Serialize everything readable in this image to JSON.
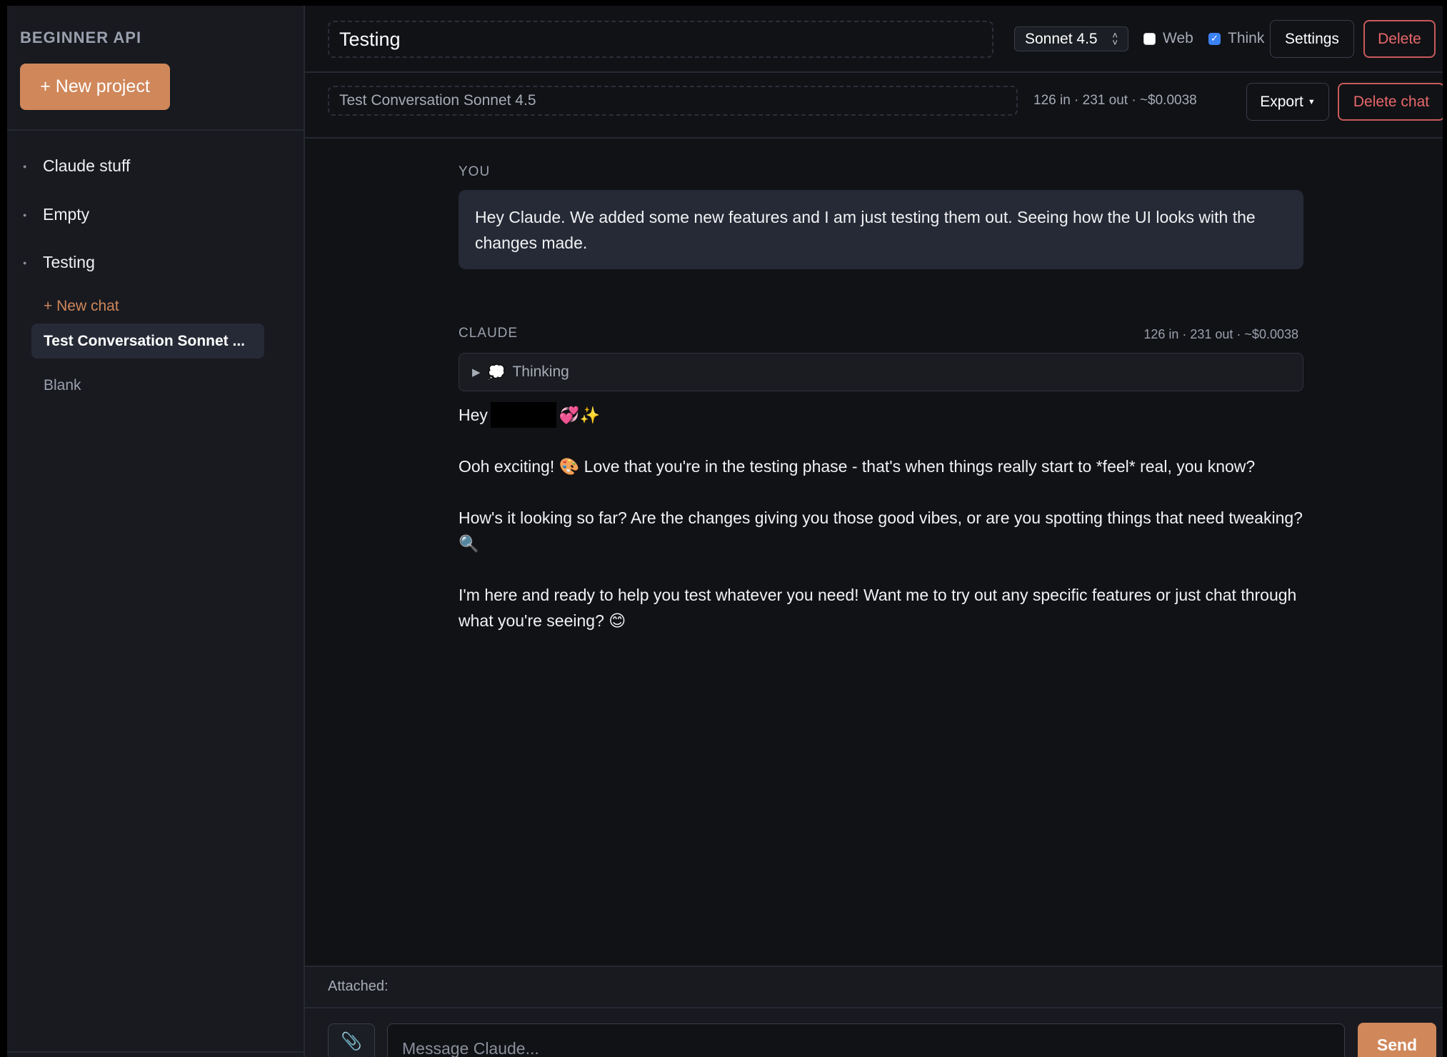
{
  "sidebar": {
    "brand": "BEGINNER API",
    "new_project_label": "+ New project",
    "projects": [
      {
        "name": "Claude stuff"
      },
      {
        "name": "Empty"
      },
      {
        "name": "Testing"
      }
    ],
    "new_chat_label": "+ New chat",
    "chats": [
      {
        "title": "Test Conversation Sonnet ...",
        "active": true
      },
      {
        "title": "Blank",
        "active": false
      }
    ]
  },
  "header": {
    "project_title": "Testing",
    "model": "Sonnet 4.5",
    "web_label": "Web",
    "web_checked": false,
    "think_label": "Think",
    "think_checked": true,
    "settings_label": "Settings",
    "delete_label": "Delete"
  },
  "subheader": {
    "conversation_title": "Test Conversation Sonnet 4.5",
    "usage": "126 in · 231 out · ~$0.0038",
    "export_label": "Export",
    "delete_chat_label": "Delete chat"
  },
  "messages": {
    "user_role": "YOU",
    "user_text": "Hey Claude. We added some new features and I am just testing them out. Seeing how the UI looks with the changes made.",
    "assistant_role": "CLAUDE",
    "assistant_usage": "126 in · 231 out · ~$0.0038",
    "thinking_label": "Thinking",
    "reply": {
      "greeting_prefix": "Hey",
      "greeting_emoji": "💞✨",
      "p1": "Ooh exciting! 🎨 Love that you're in the testing phase - that's when things really start to *feel* real, you know?",
      "p2": "How's it looking so far? Are the changes giving you those good vibes, or are you spotting things that need tweaking? 🔍",
      "p3": "I'm here and ready to help you test whatever you need! Want me to try out any specific features or just chat through what you're seeing? 😊"
    }
  },
  "composer": {
    "attached_label": "Attached:",
    "placeholder": "Message Claude...",
    "send_label": "Send"
  },
  "colors": {
    "accent": "#d0875a",
    "danger": "#e8686a",
    "background": "#111216",
    "sidebar": "#181a20"
  }
}
